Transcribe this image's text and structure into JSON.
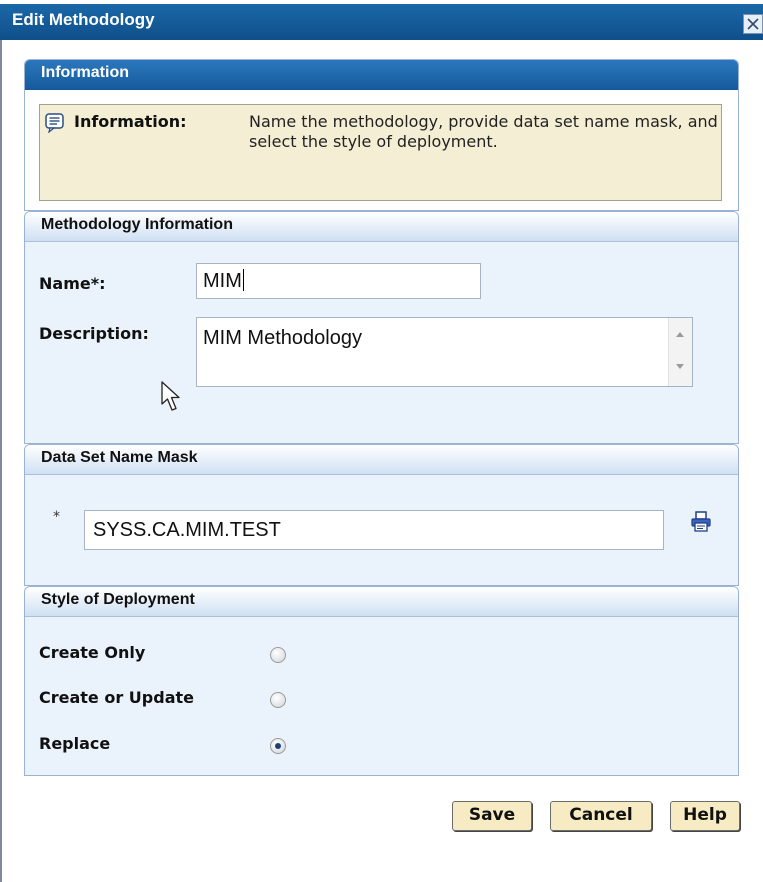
{
  "dialog": {
    "title": "Edit Methodology"
  },
  "info_panel": {
    "header": "Information",
    "label": "Information:",
    "message": "Name the methodology, provide data set name mask, and select the style of deployment."
  },
  "methodology_panel": {
    "header": "Methodology Information",
    "name_label": "Name*:",
    "name_value": "MIM",
    "description_label": "Description:",
    "description_value": "MIM Methodology"
  },
  "mask_panel": {
    "header": "Data Set Name Mask",
    "required_marker": "*",
    "mask_value": "SYSS.CA.MIM.TEST"
  },
  "deployment_panel": {
    "header": "Style of Deployment",
    "options": [
      {
        "label": "Create Only",
        "checked": false
      },
      {
        "label": "Create or Update",
        "checked": false
      },
      {
        "label": "Replace",
        "checked": true
      }
    ]
  },
  "buttons": {
    "save": "Save",
    "cancel": "Cancel",
    "help": "Help"
  },
  "icons": {
    "close": "close-icon",
    "info": "info-message-icon",
    "lookup": "lookup-icon"
  },
  "colors": {
    "title_bar": "#155a9c",
    "info_background": "#f4eed5",
    "panel_background": "#eaf2fb",
    "button_background": "#f6ebc3"
  }
}
